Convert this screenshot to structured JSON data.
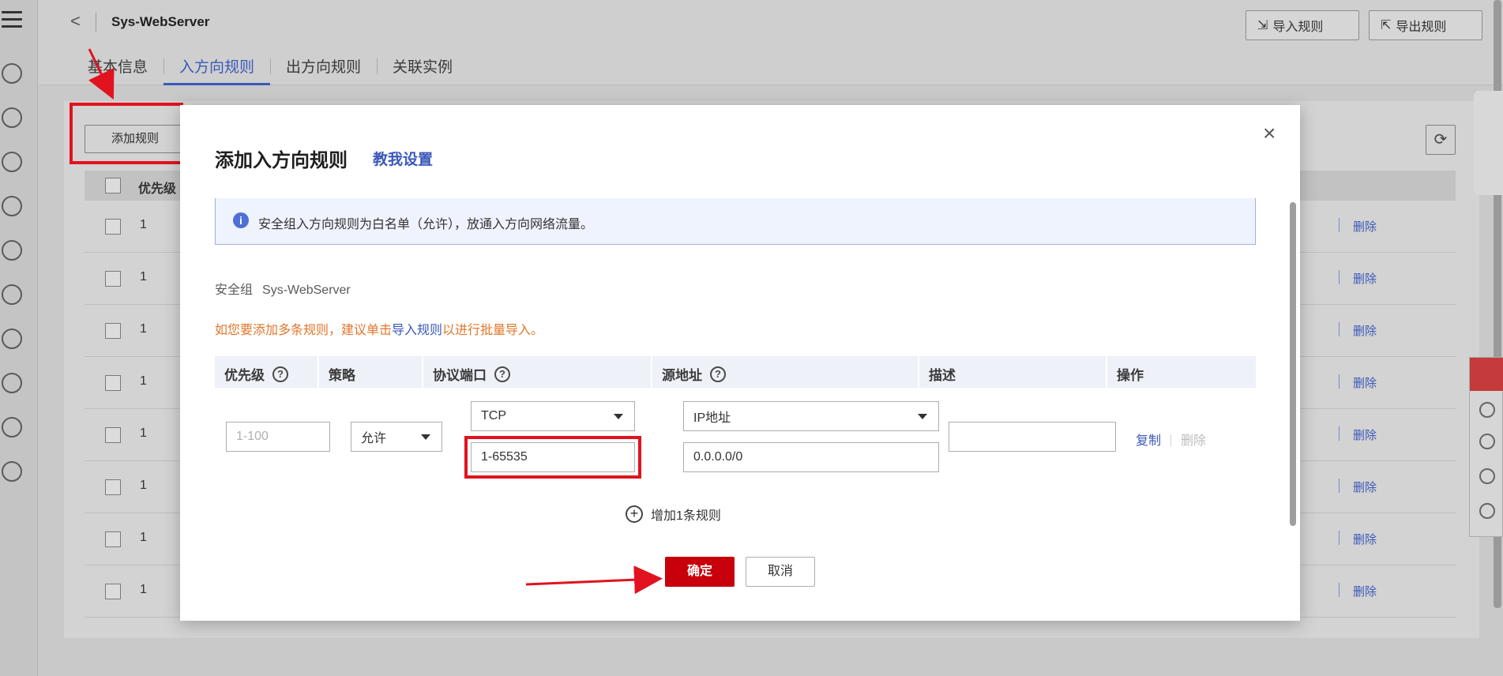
{
  "rail": {
    "icons": [
      "menu-icon",
      "cloud-server-icon",
      "cluster-icon",
      "network-icon",
      "cloud-disk-icon",
      "storage-icon",
      "backup-icon",
      "cloud-icon",
      "vpn-icon",
      "web-icon",
      "ip-icon"
    ]
  },
  "header": {
    "back_label": "<",
    "title": "Sys-WebServer",
    "tabs": [
      {
        "label": "基本信息",
        "active": false
      },
      {
        "label": "入方向规则",
        "active": true
      },
      {
        "label": "出方向规则",
        "active": false
      },
      {
        "label": "关联实例",
        "active": false
      }
    ],
    "import_label": "导入规则",
    "export_label": "导出规则"
  },
  "list": {
    "add_rule_label": "添加规则",
    "header_priority": "优先级",
    "rows": [
      {
        "priority": "1",
        "delete_label": "删除"
      },
      {
        "priority": "1",
        "delete_label": "删除"
      },
      {
        "priority": "1",
        "delete_label": "删除"
      },
      {
        "priority": "1",
        "delete_label": "删除"
      },
      {
        "priority": "1",
        "delete_label": "删除"
      },
      {
        "priority": "1",
        "delete_label": "删除"
      },
      {
        "priority": "1",
        "delete_label": "删除"
      },
      {
        "priority": "1",
        "delete_label": "删除"
      }
    ]
  },
  "dialog": {
    "title": "添加入方向规则",
    "help_link": "教我设置",
    "close_label": "×",
    "info_text": "安全组入方向规则为白名单（允许），放通入方向网络流量。",
    "security_group_label": "安全组",
    "security_group_value": "Sys-WebServer",
    "tip_prefix": "如您要添加多条规则，建议单击",
    "tip_link": "导入规则",
    "tip_suffix": "以进行批量导入。",
    "columns": {
      "priority": "优先级",
      "policy": "策略",
      "protocol_port": "协议端口",
      "source": "源地址",
      "description": "描述",
      "actions": "操作"
    },
    "rule": {
      "priority_placeholder": "1-100",
      "policy": "允许",
      "protocol": "TCP",
      "port": "1-65535",
      "source_type": "IP地址",
      "source_value": "0.0.0.0/0",
      "description": "",
      "copy_label": "复制",
      "delete_label": "删除"
    },
    "add_more_label": "增加1条规则",
    "ok_label": "确定",
    "cancel_label": "取消"
  },
  "colors": {
    "primary_red": "#c7000b",
    "link_blue": "#3b58b8",
    "annotation_red": "#e0131f",
    "tip_orange": "#e2762a"
  }
}
